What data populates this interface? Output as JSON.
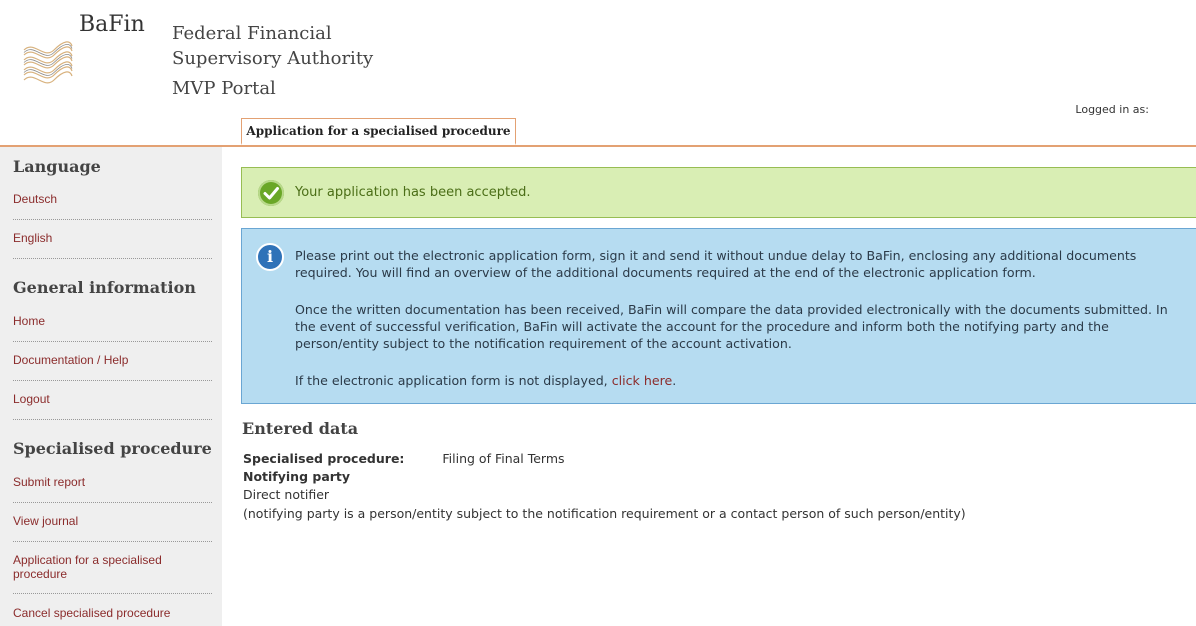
{
  "header": {
    "brand": "BaFin",
    "authority_line1": "Federal Financial",
    "authority_line2": "Supervisory Authority",
    "portal": "MVP Portal",
    "logged_in": "Logged in as:"
  },
  "tabs": [
    {
      "label": "Application for a specialised procedure",
      "active": true
    }
  ],
  "sidebar": {
    "language_heading": "Language",
    "language_items": [
      "Deutsch",
      "English"
    ],
    "general_heading": "General information",
    "general_items": [
      "Home",
      "Documentation / Help",
      "Logout"
    ],
    "procedure_heading": "Specialised procedure",
    "procedure_items": [
      "Submit report",
      "View journal",
      "Application for a specialised procedure",
      "Cancel specialised procedure"
    ]
  },
  "success": {
    "text": "Your application has been accepted."
  },
  "info": {
    "p1": "Please print out the electronic application form, sign it and send it without undue delay to BaFin, enclosing any additional documents required. You will find an overview of the additional documents required at the end of the electronic application form.",
    "p2": "Once the written documentation has been received, BaFin will compare the data provided electronically with the documents submitted. In the event of successful verification, BaFin will activate the account for the procedure and inform both the notifying party and the person/entity subject to the notification requirement of the account activation.",
    "p3_prefix": "If the electronic application form is not displayed, ",
    "p3_link": "click here",
    "p3_suffix": "."
  },
  "entered_data": {
    "title": "Entered data",
    "procedure_label": "Specialised procedure:",
    "procedure_value": "Filing of Final Terms",
    "notifying_label": "Notifying party",
    "notifying_value": "Direct notifier",
    "notifying_note": "(notifying party is a person/entity subject to the notification requirement or a contact person of such person/entity)"
  },
  "colors": {
    "accent_orange": "#e3a173",
    "link_red": "#8b2c2c",
    "success_bg": "#d9eeb4",
    "info_bg": "#b6dcf1"
  }
}
